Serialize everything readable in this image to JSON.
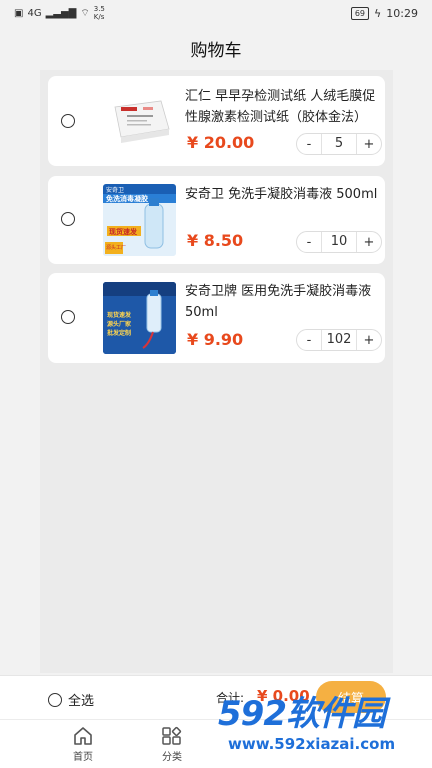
{
  "status": {
    "network": "4G",
    "speed": "3.5\nK/s",
    "battery": "69",
    "time": "10:29"
  },
  "header": {
    "title": "购物车"
  },
  "cart": {
    "items": [
      {
        "title": "汇仁 早早孕检测试纸 人绒毛膜促性腺激素检测试纸（胶体金法）2...",
        "price": "¥ 20.00",
        "minus": "-",
        "qty": "5",
        "plus": "+"
      },
      {
        "title": "安奇卫 免洗手凝胶消毒液 500ml",
        "price": "¥ 8.50",
        "minus": "-",
        "qty": "10",
        "plus": "+",
        "thumb_texts": [
          "安奇卫",
          "免洗消毒凝胶",
          "现货速发",
          "源头工厂"
        ]
      },
      {
        "title": "安奇卫牌 医用免洗手凝胶消毒液 50ml",
        "price": "¥ 9.90",
        "minus": "-",
        "qty": "102",
        "plus": "+",
        "thumb_texts": [
          "现货速发",
          "源头厂家",
          "批发定制"
        ]
      }
    ]
  },
  "footer": {
    "select_all": "全选",
    "total_label": "合计:",
    "total_price": "¥ 0.00",
    "checkout": "结算"
  },
  "tabs": [
    {
      "label": "首页",
      "icon": "home-icon"
    },
    {
      "label": "分类",
      "icon": "category-icon"
    }
  ],
  "watermark": {
    "main": "592软件园",
    "sub": "www.592xiazai.com"
  },
  "colors": {
    "accent": "#e8491d",
    "checkout": "#f5b042",
    "watermark": "#1e6fd9"
  }
}
